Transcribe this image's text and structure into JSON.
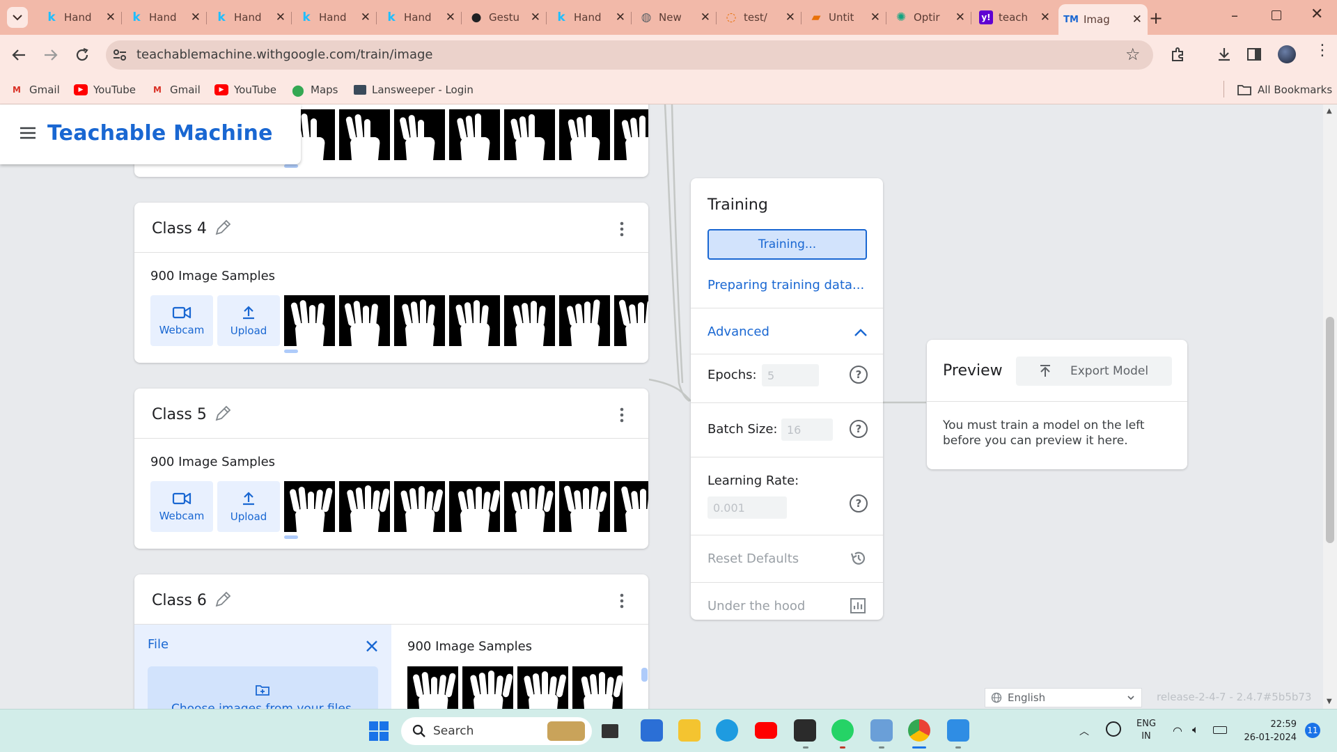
{
  "browser": {
    "tabs": [
      {
        "title": "Hand",
        "icon": "kaggle-icon"
      },
      {
        "title": "Hand",
        "icon": "kaggle-icon"
      },
      {
        "title": "Hand",
        "icon": "kaggle-icon"
      },
      {
        "title": "Hand",
        "icon": "kaggle-icon"
      },
      {
        "title": "Hand",
        "icon": "kaggle-icon"
      },
      {
        "title": "Gestu",
        "icon": "github-icon"
      },
      {
        "title": "Hand",
        "icon": "kaggle-icon"
      },
      {
        "title": "New",
        "icon": "globe-icon"
      },
      {
        "title": "test/",
        "icon": "loading-icon"
      },
      {
        "title": "Untit",
        "icon": "doc-icon"
      },
      {
        "title": "Optir",
        "icon": "openai-icon"
      },
      {
        "title": "teach",
        "icon": "yahoo-icon"
      },
      {
        "title": "Imag",
        "icon": "teachable-machine-icon"
      }
    ],
    "url": "teachablemachine.withgoogle.com/train/image",
    "bookmarks": [
      {
        "label": "Gmail",
        "icon": "gmail-icon"
      },
      {
        "label": "YouTube",
        "icon": "youtube-icon"
      },
      {
        "label": "Gmail",
        "icon": "gmail-icon"
      },
      {
        "label": "YouTube",
        "icon": "youtube-icon"
      },
      {
        "label": "Maps",
        "icon": "maps-icon"
      },
      {
        "label": "Lansweeper - Login",
        "icon": "lansweeper-icon"
      }
    ],
    "all_bookmarks": "All Bookmarks"
  },
  "app": {
    "title": "Teachable Machine"
  },
  "classes": [
    {
      "name": "Class 4",
      "samples": "900 Image Samples",
      "webcam": "Webcam",
      "upload": "Upload"
    },
    {
      "name": "Class 5",
      "samples": "900 Image Samples",
      "webcam": "Webcam",
      "upload": "Upload"
    },
    {
      "name": "Class 6",
      "samples": "900 Image Samples",
      "file_label": "File",
      "choose_files": "Choose images from your files"
    }
  ],
  "training": {
    "title": "Training",
    "button": "Training...",
    "status": "Preparing training data...",
    "advanced": "Advanced",
    "epochs_label": "Epochs:",
    "epochs_value": "5",
    "batch_label": "Batch Size:",
    "batch_value": "16",
    "lr_label": "Learning Rate:",
    "lr_value": "0.001",
    "reset": "Reset Defaults",
    "under_hood": "Under the hood"
  },
  "preview": {
    "title": "Preview",
    "export": "Export Model",
    "message": "You must train a model on the left before you can preview it here."
  },
  "footer": {
    "language": "English",
    "release": "release-2-4-7 - 2.4.7#5b5b73"
  },
  "taskbar": {
    "search_placeholder": "Search",
    "lang_top": "ENG",
    "lang_bottom": "IN",
    "time": "22:59",
    "date": "26-01-2024",
    "notification_count": "11"
  },
  "colors": {
    "accent": "#1967d2",
    "tab_bar": "#f2b9a9",
    "toolbar": "#fce8e3",
    "taskbar": "#d2ede9"
  }
}
